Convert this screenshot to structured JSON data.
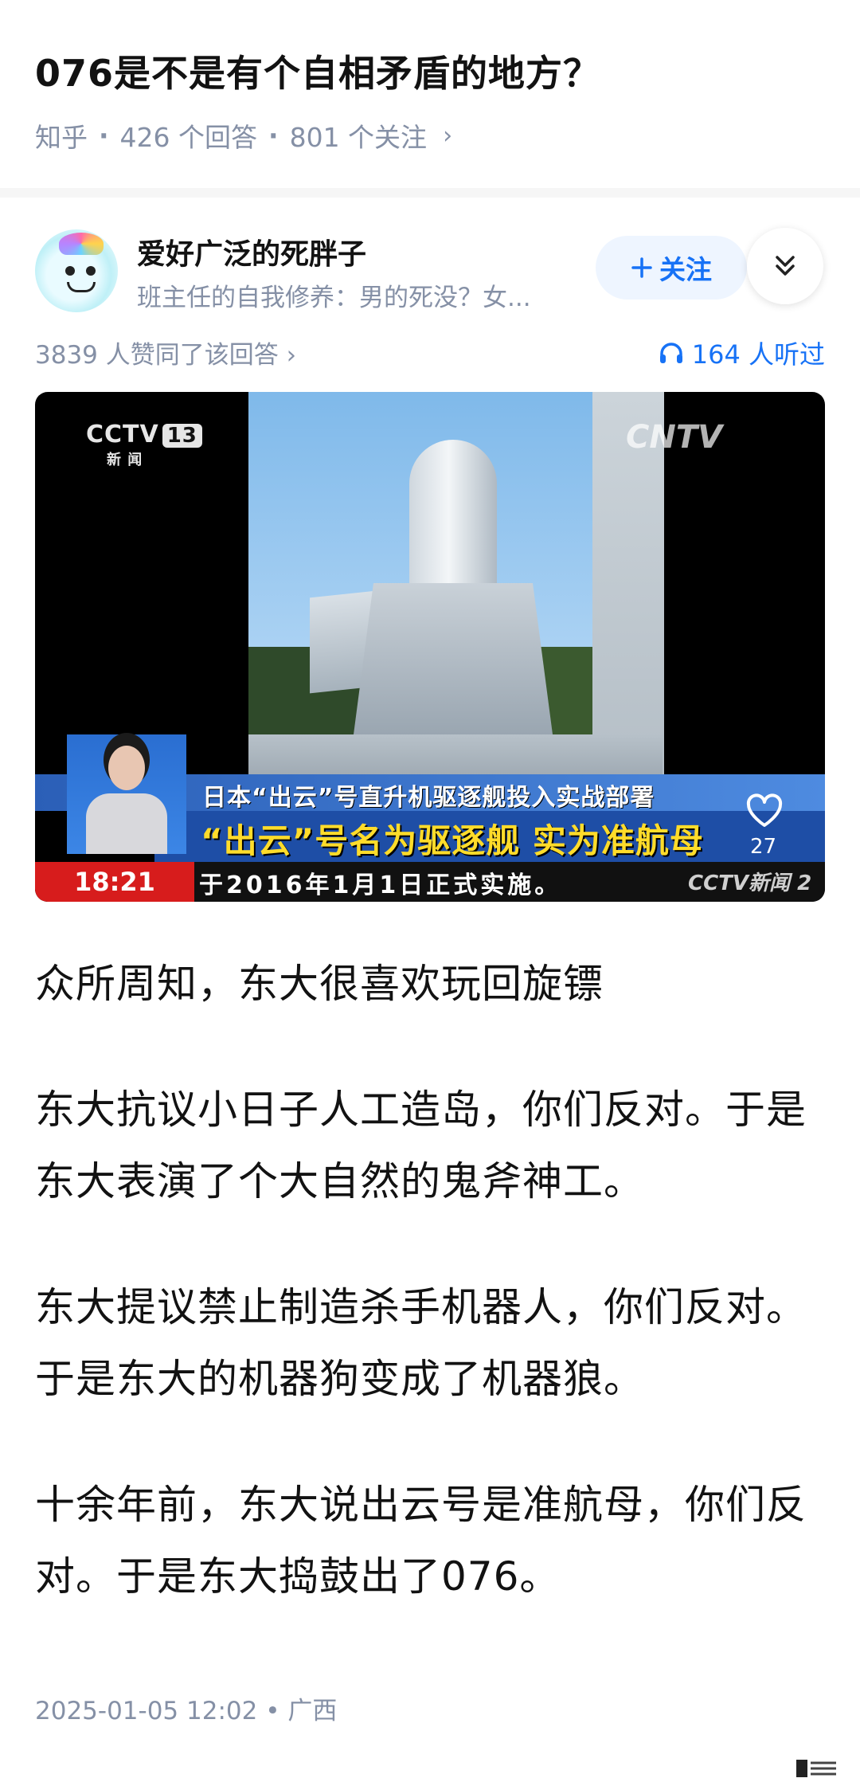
{
  "question": {
    "title": "076是不是有个自相矛盾的地方？",
    "source": "知乎",
    "answers": "426 个回答",
    "followers": "801 个关注",
    "chevron": "›"
  },
  "author": {
    "name": "爱好广泛的死胖子",
    "bio": "班主任的自我修养：男的死没？女...",
    "follow_label": "关注",
    "follow_icon": "plus-icon",
    "more_icon": "double-chevron-down-icon"
  },
  "stats": {
    "agree": "3839 人赞同了该回答",
    "agree_chevron": "›",
    "listen": "164 人听过",
    "listen_icon": "headphones-icon"
  },
  "media": {
    "logo_top_left": "CCTV",
    "logo_channel": "13",
    "logo_sub": "新 闻",
    "logo_top_right": "CNTV",
    "caption_line1": "日本“出云”号直升机驱逐舰投入实战部署",
    "caption_line2": "“出云”号名为驱逐舰 实为准航母",
    "clock": "18:21",
    "ticker": "于2016年1月1日正式实施。",
    "ticker_logo": "CCTV新闻 2",
    "like_count": "27"
  },
  "body": [
    "众所周知，东大很喜欢玩回旋镖",
    "东大抗议小日子人工造岛，你们反对。于是东大表演了个大自然的鬼斧神工。",
    "东大提议禁止制造杀手机器人，你们反对。于是东大的机器狗变成了机器狼。",
    "十余年前，东大说出云号是准航母，你们反对。于是东大捣鼓出了076。"
  ],
  "footer": {
    "timestamp": "2025-01-05 12:02 • 广西"
  },
  "colors": {
    "accent": "#1772f6",
    "muted": "#8590a6",
    "text": "#121212"
  }
}
